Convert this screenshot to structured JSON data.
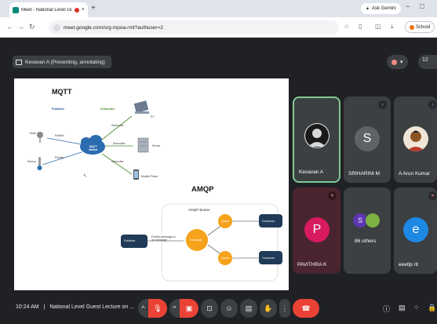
{
  "browser": {
    "tab_title": "Meet - National Level Gue",
    "tab_close": "×",
    "new_tab": "+",
    "gemini_label": "Ask Gemini",
    "url": "meet.google.com/srg-mpoa-rmt?authuser=2",
    "profile_label": "School",
    "window_controls": [
      "−",
      "□"
    ]
  },
  "meet": {
    "presenting_label": "Kesavan A (Presenting, annotating)",
    "more_participants_count": "12"
  },
  "slide": {
    "mqtt_title": "MQTT",
    "publisher_label": "Publisher",
    "subscriber_label": "Subscriber",
    "broker_label": "MQTT Broker",
    "mote_label": "Mote",
    "sensor_label": "Sensor",
    "pc_label": "PC",
    "server_label": "Server",
    "phone_label": "Mobile Phone",
    "publish_label": "Publish",
    "subscribe_label": "Subscribe",
    "amqp_title": "AMQP",
    "amqp_broker_label": "AMQP Broker",
    "publisher_box": "Publisher",
    "exchange_label": "Exchange",
    "queue_label": "Queue",
    "consumer_label": "Consumer",
    "publish_msg_label": "Publish message to an exchange"
  },
  "participants": [
    {
      "name": "Kesavan A",
      "initial": "",
      "color": "#3c4043"
    },
    {
      "name": "SRIHARINI M",
      "initial": "S",
      "color": "#5f6368"
    },
    {
      "name": "A Arun Kumar",
      "initial": "",
      "color": "#3c4043"
    },
    {
      "name": "PAVITHRA K",
      "initial": "P",
      "color": "#d81b60"
    },
    {
      "name": "86 others",
      "initial": "S",
      "color": "#5e35b1"
    },
    {
      "name": "eeetlp rit",
      "initial": "e",
      "color": "#1e88e5"
    }
  ],
  "bottom": {
    "time": "10:24 AM",
    "separator": "|",
    "meeting_title": "National Level Guest Lecture on ..."
  },
  "colors": {
    "accent_red": "#ea4335",
    "meet_bg": "#202124",
    "active_speaker_border": "#81c995"
  }
}
